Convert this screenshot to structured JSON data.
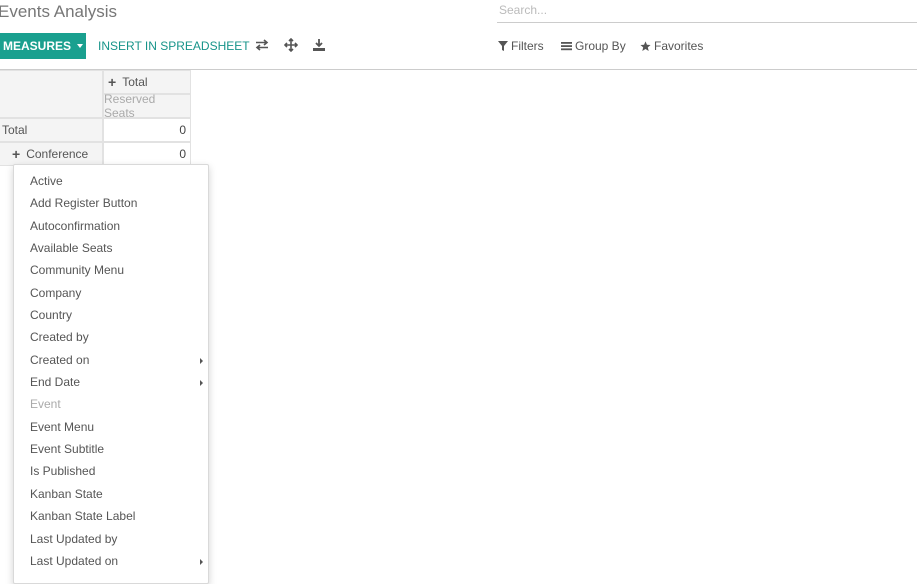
{
  "page": {
    "title": "Events Analysis"
  },
  "search": {
    "placeholder": "Search..."
  },
  "toolbar": {
    "measures_label": "MEASURES",
    "insert_label": "INSERT IN SPREADSHEET",
    "icons": [
      "flip-axis-icon",
      "expand-all-icon",
      "download-icon"
    ]
  },
  "filters": {
    "filters_label": "Filters",
    "groupby_label": "Group By",
    "favorites_label": "Favorites"
  },
  "pivot": {
    "col_header": "Total",
    "measure_header": "Reserved Seats",
    "rows": [
      {
        "label": "Total",
        "value": "0"
      },
      {
        "label": "Conference",
        "value": "0"
      }
    ]
  },
  "measures_menu": {
    "items": [
      {
        "label": "Active"
      },
      {
        "label": "Add Register Button"
      },
      {
        "label": "Autoconfirmation"
      },
      {
        "label": "Available Seats"
      },
      {
        "label": "Community Menu"
      },
      {
        "label": "Company"
      },
      {
        "label": "Country"
      },
      {
        "label": "Created by"
      },
      {
        "label": "Created on",
        "submenu": true
      },
      {
        "label": "End Date",
        "submenu": true
      },
      {
        "label": "Event",
        "disabled": true
      },
      {
        "label": "Event Menu"
      },
      {
        "label": "Event Subtitle"
      },
      {
        "label": "Is Published"
      },
      {
        "label": "Kanban State"
      },
      {
        "label": "Kanban State Label"
      },
      {
        "label": "Last Updated by"
      },
      {
        "label": "Last Updated on",
        "submenu": true
      }
    ]
  },
  "colors": {
    "accent": "#1aa08f",
    "link": "#17948a",
    "header_bg": "#f4f4f4"
  }
}
